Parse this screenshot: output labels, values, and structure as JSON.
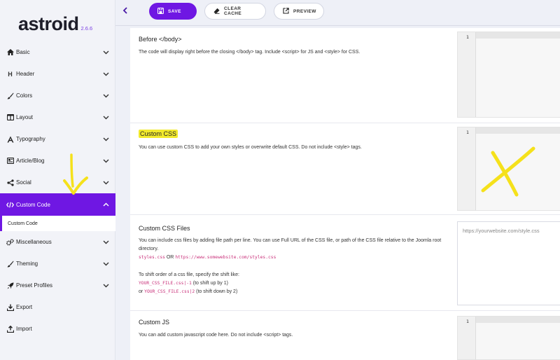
{
  "app": {
    "name": "astroid",
    "version": "2.6.6"
  },
  "sidebar": {
    "items": [
      {
        "label": "Basic",
        "icon": "home-icon"
      },
      {
        "label": "Header",
        "icon": "header-icon"
      },
      {
        "label": "Colors",
        "icon": "brush-icon"
      },
      {
        "label": "Layout",
        "icon": "layout-icon"
      },
      {
        "label": "Typography",
        "icon": "typography-icon"
      },
      {
        "label": "Article/Blog",
        "icon": "newspaper-icon"
      },
      {
        "label": "Social",
        "icon": "share-icon"
      },
      {
        "label": "Custom Code",
        "icon": "code-icon",
        "active": true
      },
      {
        "label": "Miscellaneous",
        "icon": "cogs-icon"
      },
      {
        "label": "Theming",
        "icon": "paint-roller-icon"
      },
      {
        "label": "Preset Profiles",
        "icon": "rocket-icon"
      },
      {
        "label": "Export",
        "icon": "download-icon"
      },
      {
        "label": "Import",
        "icon": "upload-icon"
      }
    ],
    "sub_item": "Custom Code"
  },
  "toolbar": {
    "save_label": "SAVE",
    "clear_cache_label": "CLEAR CACHE",
    "preview_label": "PREVIEW"
  },
  "sections": {
    "before_body": {
      "title": "Before </body>",
      "desc": "The code will display right before the closing </body> tag. Include <script> for JS and <style> for CSS.",
      "line": "1"
    },
    "custom_css": {
      "title": "Custom CSS",
      "desc": "You can use custom CSS to add your own styles or overwrite default CSS. Do not include <style> tags.",
      "line": "1"
    },
    "custom_css_files": {
      "title": "Custom CSS Files",
      "desc1": "You can include css files by adding file path per line. You can use Full URL of the CSS file, or path of the CSS file relative to the Joomla root directory.",
      "ex_local": "styles.css",
      "or": " OR ",
      "ex_url": "https://www.somewebsite.com/styles.css",
      "shift_intro": "To shift order of a css file, specify the shift like:",
      "shift_up_code": "YOUR_CSS_FILE.css|-1",
      "shift_up_text": " (to shift up by 1)",
      "or_prefix": "or ",
      "shift_down_code": "YOUR_CSS_FILE.css|2",
      "shift_down_text": " (to shift down by 2)",
      "placeholder": "https://yourwebsite.com/style.css"
    },
    "custom_js": {
      "title": "Custom JS",
      "desc": "You can add custom javascript code here. Do not include <script> tags.",
      "line": "1"
    }
  },
  "colors": {
    "accent": "#6f17e3",
    "highlight": "#f2ea2c",
    "annotation": "#f5e11b"
  }
}
